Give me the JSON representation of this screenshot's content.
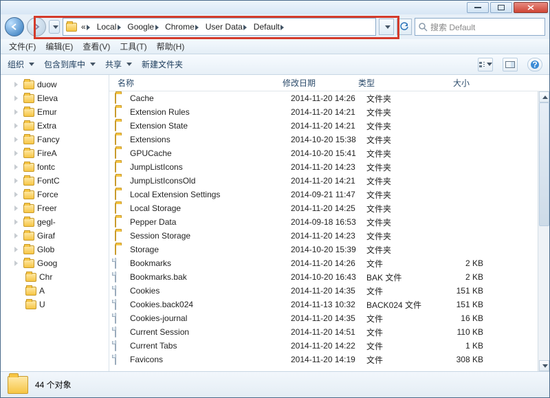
{
  "titlebar": {
    "min": "–",
    "max": "☐",
    "close": "✕"
  },
  "nav": {
    "back": "◀",
    "fwd": "▶",
    "crumbs": [
      "«",
      "Local",
      "Google",
      "Chrome",
      "User Data",
      "Default"
    ],
    "refresh": "↻",
    "search_placeholder": "搜索 Default"
  },
  "menubar": [
    "文件(F)",
    "编辑(E)",
    "查看(V)",
    "工具(T)",
    "帮助(H)"
  ],
  "toolbar": {
    "organize": "组织",
    "include": "包含到库中",
    "share": "共享",
    "newfolder": "新建文件夹"
  },
  "sidebar": [
    {
      "ind": 1,
      "label": "duow"
    },
    {
      "ind": 1,
      "label": "Eleva"
    },
    {
      "ind": 1,
      "label": "Emur"
    },
    {
      "ind": 1,
      "label": "Extra"
    },
    {
      "ind": 1,
      "label": "Fancy"
    },
    {
      "ind": 1,
      "label": "FireA"
    },
    {
      "ind": 1,
      "label": "fontc"
    },
    {
      "ind": 1,
      "label": "FontC"
    },
    {
      "ind": 1,
      "label": "Force"
    },
    {
      "ind": 1,
      "label": "Freer"
    },
    {
      "ind": 1,
      "label": "gegl-"
    },
    {
      "ind": 1,
      "label": "Giraf"
    },
    {
      "ind": 1,
      "label": "Glob"
    },
    {
      "ind": 1,
      "label": "Goog"
    },
    {
      "ind": 2,
      "label": "Chr"
    },
    {
      "ind": 2,
      "label": "A"
    },
    {
      "ind": 2,
      "label": "U"
    }
  ],
  "columns": {
    "name": "名称",
    "date": "修改日期",
    "type": "类型",
    "size": "大小"
  },
  "files": [
    {
      "icon": "folder",
      "name": "Cache",
      "date": "2014-11-20 14:26",
      "type": "文件夹",
      "size": ""
    },
    {
      "icon": "folder",
      "name": "Extension Rules",
      "date": "2014-11-20 14:21",
      "type": "文件夹",
      "size": ""
    },
    {
      "icon": "folder",
      "name": "Extension State",
      "date": "2014-11-20 14:21",
      "type": "文件夹",
      "size": ""
    },
    {
      "icon": "folder",
      "name": "Extensions",
      "date": "2014-10-20 15:38",
      "type": "文件夹",
      "size": ""
    },
    {
      "icon": "folder",
      "name": "GPUCache",
      "date": "2014-10-20 15:41",
      "type": "文件夹",
      "size": ""
    },
    {
      "icon": "folder",
      "name": "JumpListIcons",
      "date": "2014-11-20 14:23",
      "type": "文件夹",
      "size": ""
    },
    {
      "icon": "folder",
      "name": "JumpListIconsOld",
      "date": "2014-11-20 14:21",
      "type": "文件夹",
      "size": ""
    },
    {
      "icon": "folder",
      "name": "Local Extension Settings",
      "date": "2014-09-21 11:47",
      "type": "文件夹",
      "size": ""
    },
    {
      "icon": "folder",
      "name": "Local Storage",
      "date": "2014-11-20 14:25",
      "type": "文件夹",
      "size": ""
    },
    {
      "icon": "folder",
      "name": "Pepper Data",
      "date": "2014-09-18 16:53",
      "type": "文件夹",
      "size": ""
    },
    {
      "icon": "folder",
      "name": "Session Storage",
      "date": "2014-11-20 14:23",
      "type": "文件夹",
      "size": ""
    },
    {
      "icon": "folder",
      "name": "Storage",
      "date": "2014-10-20 15:39",
      "type": "文件夹",
      "size": ""
    },
    {
      "icon": "file",
      "name": "Bookmarks",
      "date": "2014-11-20 14:26",
      "type": "文件",
      "size": "2 KB"
    },
    {
      "icon": "file",
      "name": "Bookmarks.bak",
      "date": "2014-10-20 16:43",
      "type": "BAK 文件",
      "size": "2 KB"
    },
    {
      "icon": "file",
      "name": "Cookies",
      "date": "2014-11-20 14:35",
      "type": "文件",
      "size": "151 KB"
    },
    {
      "icon": "file",
      "name": "Cookies.back024",
      "date": "2014-11-13 10:32",
      "type": "BACK024 文件",
      "size": "151 KB"
    },
    {
      "icon": "file",
      "name": "Cookies-journal",
      "date": "2014-11-20 14:35",
      "type": "文件",
      "size": "16 KB"
    },
    {
      "icon": "file",
      "name": "Current Session",
      "date": "2014-11-20 14:51",
      "type": "文件",
      "size": "110 KB"
    },
    {
      "icon": "file",
      "name": "Current Tabs",
      "date": "2014-11-20 14:22",
      "type": "文件",
      "size": "1 KB"
    },
    {
      "icon": "file",
      "name": "Favicons",
      "date": "2014-11-20 14:19",
      "type": "文件",
      "size": "308 KB"
    }
  ],
  "status": {
    "count": "44 个对象"
  }
}
